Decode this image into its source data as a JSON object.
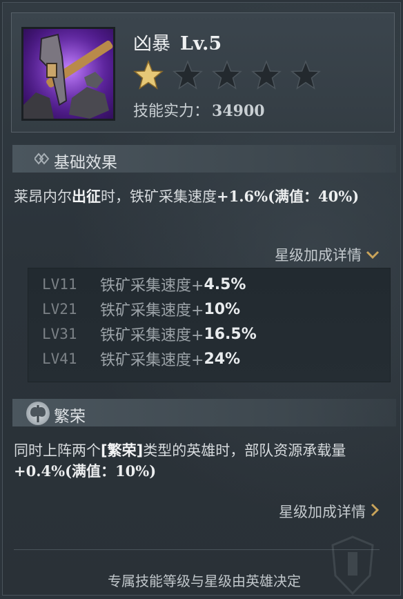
{
  "skill": {
    "name": "凶暴",
    "level": "Lv.5",
    "stars_total": 5,
    "stars_filled": 1,
    "power_label": "技能实力：",
    "power_value": "34900"
  },
  "basic": {
    "title": "基础效果",
    "desc_pre": "莱昂内尔",
    "desc_hl": "出征",
    "desc_mid": "时，铁矿采集速度",
    "desc_val": "+1.6%(满值：40%)",
    "detail_label": "星级加成详情",
    "levels": [
      {
        "lv": "LV11",
        "text": "铁矿采集速度+",
        "pct": "4.5%"
      },
      {
        "lv": "LV21",
        "text": "铁矿采集速度+",
        "pct": "10%"
      },
      {
        "lv": "LV31",
        "text": "铁矿采集速度+",
        "pct": "16.5%"
      },
      {
        "lv": "LV41",
        "text": "铁矿采集速度+",
        "pct": "24%"
      }
    ]
  },
  "prosperity": {
    "title": "繁荣",
    "desc_pre": "同时上阵两个",
    "desc_tag": "[繁荣]",
    "desc_mid": "类型的英雄时，部队资源承载量",
    "desc_val": "+0.4%(满值：10%)",
    "detail_label": "星级加成详情"
  },
  "footer": {
    "note": "专属技能等级与星级由英雄决定"
  },
  "colors": {
    "star_filled": "#e6c877",
    "star_empty": "#23292e",
    "icon_purple": "#8f3de8"
  }
}
